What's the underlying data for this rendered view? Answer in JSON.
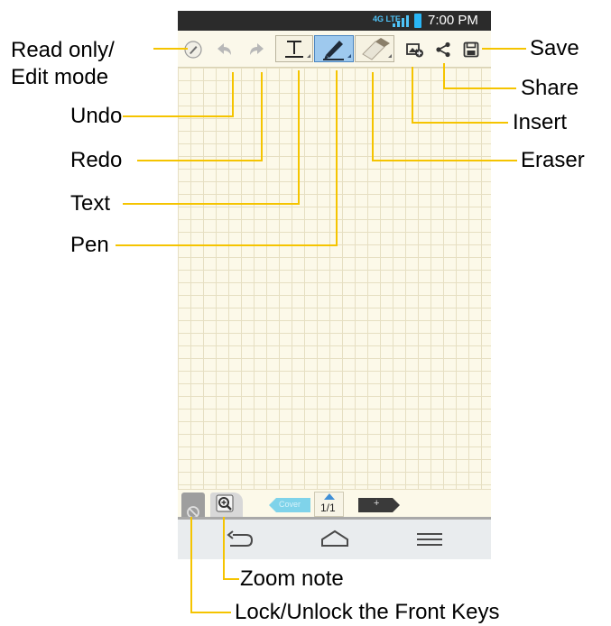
{
  "status_bar": {
    "network": "4G LTE",
    "time": "7:00 PM"
  },
  "toolbar": {
    "items": [
      {
        "name": "read-only-edit-mode-button",
        "icon": "pen-circle-icon"
      },
      {
        "name": "undo-button",
        "icon": "undo-arrow-icon"
      },
      {
        "name": "redo-button",
        "icon": "redo-arrow-icon"
      },
      {
        "name": "text-tool-button",
        "icon": "text-t-icon"
      },
      {
        "name": "pen-tool-button",
        "icon": "pen-icon",
        "selected": true
      },
      {
        "name": "eraser-tool-button",
        "icon": "eraser-icon"
      },
      {
        "name": "insert-button",
        "icon": "insert-image-icon"
      },
      {
        "name": "share-button",
        "icon": "share-icon"
      },
      {
        "name": "save-button",
        "icon": "save-floppy-icon"
      }
    ]
  },
  "page_nav": {
    "prev_label": "Cover",
    "page_indicator": "1/1",
    "next_label": "+"
  },
  "callouts": {
    "read_only": "Read only/\nEdit mode",
    "undo": "Undo",
    "redo": "Redo",
    "text": "Text",
    "pen": "Pen",
    "save": "Save",
    "share": "Share",
    "insert": "Insert",
    "eraser": "Eraser",
    "zoom_note": "Zoom note",
    "lock_keys": "Lock/Unlock the Front Keys"
  },
  "colors": {
    "callout_line": "#f5c400",
    "active_tool": "#9ec9ee",
    "paper": "#fcf9e9",
    "grid": "#e6dfc2",
    "status_bar": "#2b2b2b"
  }
}
